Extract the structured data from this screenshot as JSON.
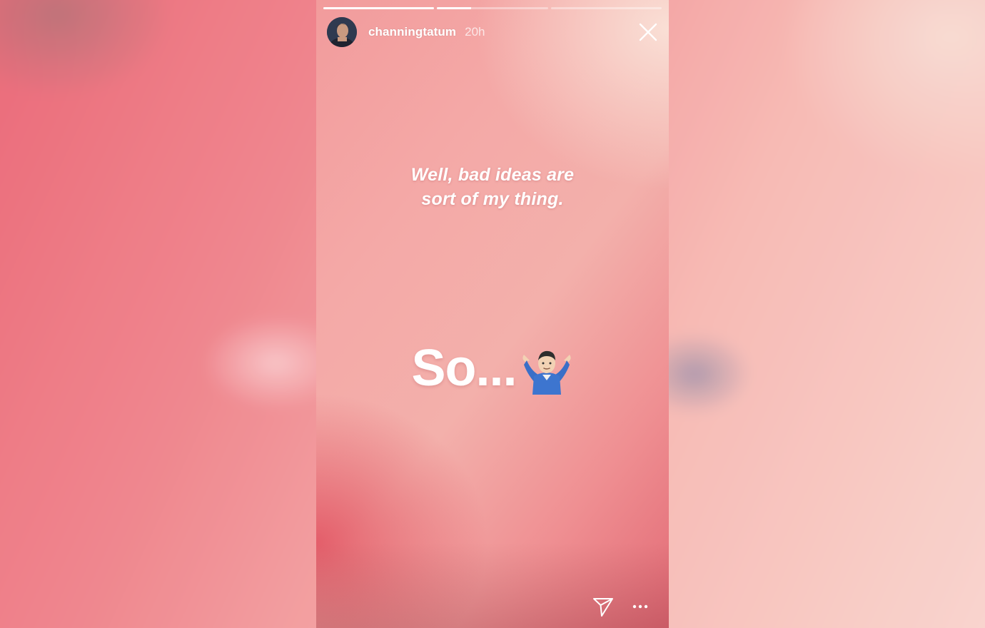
{
  "story": {
    "username": "channingtatum",
    "timestamp": "20h",
    "progress": [
      1.0,
      0.31,
      0.0
    ],
    "caption_lines": [
      "Well, bad ideas are",
      "sort of my thing."
    ],
    "big_text": "So...",
    "emoji": "man-shrugging-icon"
  },
  "icons": {
    "close": "close-icon",
    "send": "send-icon",
    "more": "more-options-icon"
  },
  "colors": {
    "background_start": "#f29b9c",
    "background_end": "#e26a75",
    "text": "#ffffff"
  }
}
